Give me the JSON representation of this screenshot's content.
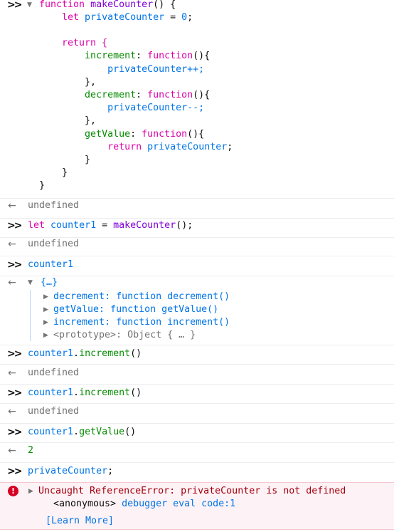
{
  "console": {
    "entry1": {
      "code_lines": [
        [
          "function ",
          "makeCounter",
          "() {"
        ],
        [
          "    let ",
          "privateCounter",
          " = ",
          "0",
          ";"
        ],
        [
          ""
        ],
        [
          "    return {"
        ],
        [
          "        ",
          "increment",
          ": ",
          "function",
          "(){"
        ],
        [
          "            ",
          "privateCounter",
          "++;"
        ],
        [
          "        },"
        ],
        [
          "        ",
          "decrement",
          ": ",
          "function",
          "(){"
        ],
        [
          "            ",
          "privateCounter",
          "--;"
        ],
        [
          "        },"
        ],
        [
          "        ",
          "getValue",
          ": ",
          "function",
          "(){"
        ],
        [
          "            ",
          "return",
          " ",
          "privateCounter",
          ";"
        ],
        [
          "        }"
        ],
        [
          "    }"
        ],
        [
          "}"
        ]
      ],
      "result": "undefined"
    },
    "entry2": {
      "code": [
        "let",
        " ",
        "counter1",
        " = ",
        "makeCounter",
        "();"
      ],
      "result": "undefined"
    },
    "entry3": {
      "code": "counter1",
      "object_summary": "{…}",
      "props": [
        {
          "key": "decrement",
          "value": "function decrement()"
        },
        {
          "key": "getValue",
          "value": "function getValue()"
        },
        {
          "key": "increment",
          "value": "function increment()"
        },
        {
          "key": "<prototype>",
          "value": "Object { … }"
        }
      ]
    },
    "entry4": {
      "code": [
        "counter1",
        ".",
        "increment",
        "()"
      ],
      "result": "undefined"
    },
    "entry5": {
      "code": [
        "counter1",
        ".",
        "increment",
        "()"
      ],
      "result": "undefined"
    },
    "entry6": {
      "code": [
        "counter1",
        ".",
        "getValue",
        "()"
      ],
      "result": "2"
    },
    "entry7": {
      "code": [
        "privateCounter",
        ";"
      ]
    },
    "error": {
      "message": "Uncaught ReferenceError: privateCounter is not defined",
      "frame_name": "<anonymous>",
      "frame_location": "debugger eval code:1",
      "learn_more": "[Learn More]"
    }
  },
  "icons": {
    "prompt": "chevron-double-right-icon",
    "result": "arrow-left-icon",
    "expand": "triangle-down-icon",
    "collapsed": "triangle-right-icon",
    "error": "error-icon"
  },
  "colors": {
    "keyword": "#dd00a9",
    "variable": "#0074e8",
    "property": "#058b00",
    "function_name": "#8000d7",
    "error_text": "#a4000f",
    "error_bg": "#fdf2f5"
  }
}
